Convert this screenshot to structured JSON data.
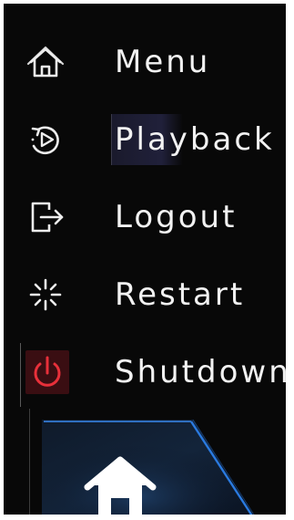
{
  "menu": {
    "items": [
      {
        "id": "menu",
        "label": "Menu",
        "icon": "home-icon"
      },
      {
        "id": "playback",
        "label": "Playback",
        "icon": "playback-icon"
      },
      {
        "id": "logout",
        "label": "Logout",
        "icon": "logout-icon"
      },
      {
        "id": "restart",
        "label": "Restart",
        "icon": "restart-icon"
      },
      {
        "id": "shutdown",
        "label": "Shutdown",
        "icon": "power-icon",
        "selected": true
      }
    ]
  },
  "colors": {
    "background": "#080808",
    "text": "#f2f2f2",
    "power_accent": "#e8303a",
    "tile_accent": "#1e78d8"
  }
}
